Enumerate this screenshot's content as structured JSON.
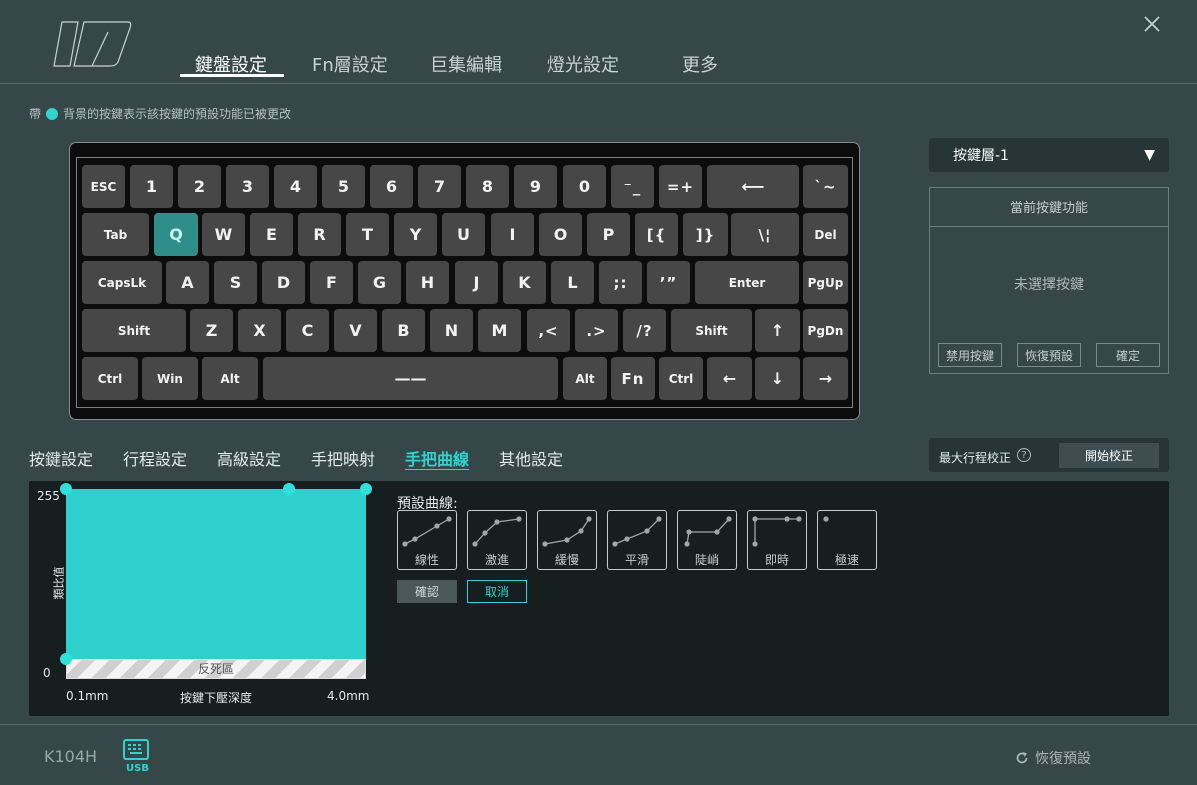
{
  "topnav": {
    "items": [
      "鍵盤設定",
      "Fn層設定",
      "巨集編輯",
      "燈光設定",
      "更多"
    ],
    "active_index": 0
  },
  "hint": {
    "prefix": "帶",
    "text": "背景的按鍵表示該按鍵的預設功能已被更改"
  },
  "keyboard": {
    "rows": [
      [
        "ESC",
        "1",
        "2",
        "3",
        "4",
        "5",
        "6",
        "7",
        "8",
        "9",
        "0",
        "⁻_",
        "=+",
        "⟵",
        "`~"
      ],
      [
        "Tab",
        "Q",
        "W",
        "E",
        "R",
        "T",
        "Y",
        "U",
        "I",
        "O",
        "P",
        "[{",
        "]}",
        "\\¦",
        "Del"
      ],
      [
        "CapsLk",
        "A",
        "S",
        "D",
        "F",
        "G",
        "H",
        "J",
        "K",
        "L",
        ";:",
        "’”",
        "Enter",
        "PgUp"
      ],
      [
        "Shift",
        "Z",
        "X",
        "C",
        "V",
        "B",
        "N",
        "M",
        ",<",
        ".>",
        "/?",
        "Shift",
        "↑",
        "PgDn"
      ],
      [
        "Ctrl",
        "Win",
        "Alt",
        "——",
        "Alt",
        "Fn",
        "Ctrl",
        "←",
        "↓",
        "→"
      ]
    ],
    "selected_key": "Q"
  },
  "layer_select": {
    "value": "按鍵層-1",
    "arrow": "▼"
  },
  "function_panel": {
    "title": "當前按鍵功能",
    "empty_text": "未選擇按鍵",
    "buttons": [
      "禁用按鍵",
      "恢復預設",
      "確定"
    ]
  },
  "subtabs": {
    "items": [
      "按鍵設定",
      "行程設定",
      "高級設定",
      "手把映射",
      "手把曲線",
      "其他設定"
    ],
    "active_index": 4
  },
  "calibration": {
    "label": "最大行程校正",
    "help": "?",
    "button": "開始校正"
  },
  "curve": {
    "y_max": "255",
    "y_min": "0",
    "y_label": "類比值",
    "x_min": "0.1mm",
    "x_max": "4.0mm",
    "x_label": "按鍵下壓深度",
    "deadzone_label": "反死區",
    "fill_color": "#2fcfcd",
    "preset_title": "預設曲線:",
    "presets": [
      "線性",
      "激進",
      "緩慢",
      "平滑",
      "陡峭",
      "即時",
      "極速"
    ],
    "confirm": "確認",
    "cancel": "取消"
  },
  "footer": {
    "device": "K104H",
    "connection": "USB",
    "restore": "恢復預設"
  }
}
